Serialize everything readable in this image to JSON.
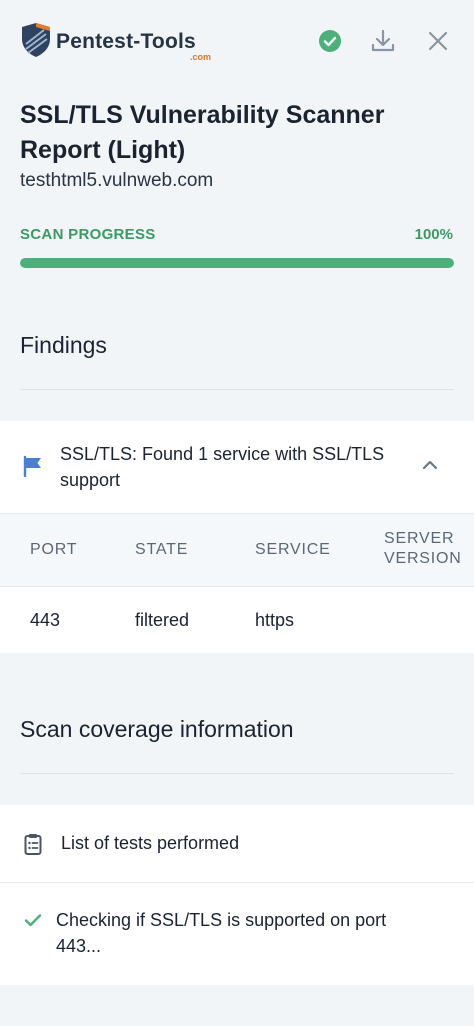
{
  "brand": {
    "name": "Pentest-Tools",
    "domain": ".com"
  },
  "header_icons": [
    "check-circle-icon",
    "download-icon",
    "close-icon"
  ],
  "report": {
    "title": "SSL/TLS Vulnerability Scanner Report (Light)",
    "target": "testhtml5.vulnweb.com"
  },
  "progress": {
    "label": "SCAN PROGRESS",
    "value_text": "100%",
    "percent": 100
  },
  "findings": {
    "heading": "Findings",
    "item": {
      "title": "SSL/TLS: Found 1 service with SSL/TLS support",
      "table": {
        "headers": [
          "PORT",
          "STATE",
          "SERVICE",
          "SERVER VERSION"
        ],
        "rows": [
          [
            "443",
            "filtered",
            "https",
            ""
          ]
        ]
      }
    }
  },
  "coverage": {
    "heading": "Scan coverage information",
    "tests_label": "List of tests performed",
    "checks": [
      "Checking if SSL/TLS is supported on port 443..."
    ]
  },
  "colors": {
    "accent_green": "#3b9a62",
    "progress_fill": "#4cb07a",
    "flag_blue": "#4a7fd4",
    "background": "#f2f5f8"
  }
}
